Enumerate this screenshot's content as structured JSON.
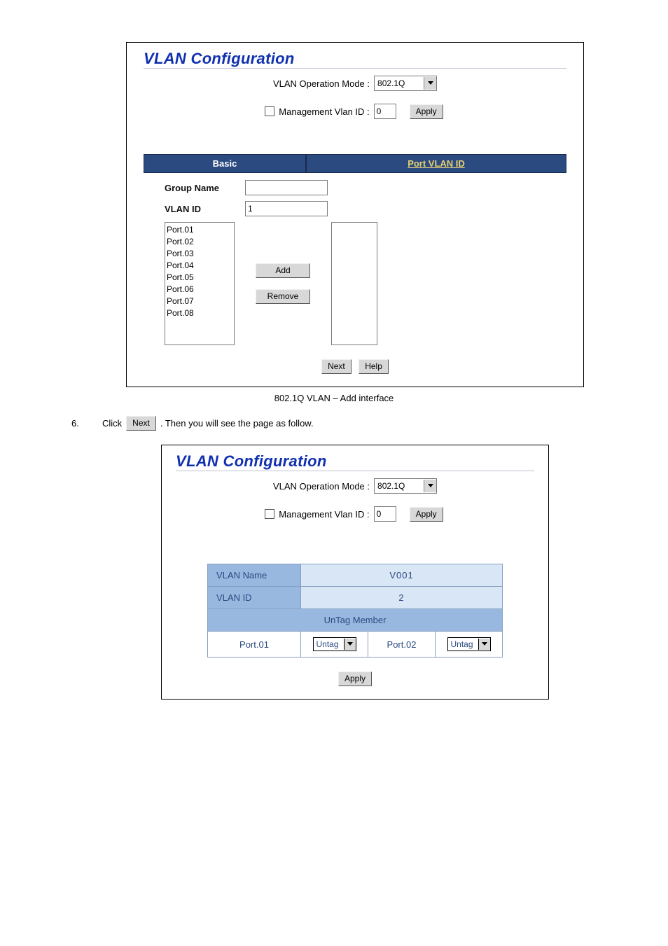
{
  "figure1": {
    "title": "VLAN Configuration",
    "op_mode_label": "VLAN Operation Mode :",
    "op_mode_value": "802.1Q",
    "mgmt_label": "Management Vlan ID :",
    "mgmt_value": "0",
    "apply_label": "Apply",
    "tabs": {
      "basic": "Basic",
      "port": "Port VLAN ID"
    },
    "group_name_label": "Group Name",
    "group_name_value": "",
    "vlan_id_label": "VLAN ID",
    "vlan_id_value": "1",
    "ports": [
      "Port.01",
      "Port.02",
      "Port.03",
      "Port.04",
      "Port.05",
      "Port.06",
      "Port.07",
      "Port.08"
    ],
    "add_label": "Add",
    "remove_label": "Remove",
    "next_label": "Next",
    "help_label": "Help",
    "caption": "802.1Q VLAN – Add interface"
  },
  "step6": {
    "num": "6.",
    "pre": "Click ",
    "btn": "Next",
    "post": ". Then you will see the page as follow."
  },
  "figure2": {
    "title": "VLAN Configuration",
    "op_mode_label": "VLAN Operation Mode :",
    "op_mode_value": "802.1Q",
    "mgmt_label": "Management Vlan ID :",
    "mgmt_value": "0",
    "apply_label": "Apply",
    "table": {
      "name_label": "VLAN Name",
      "name_value": "V001",
      "id_label": "VLAN ID",
      "id_value": "2",
      "untag_header": "UnTag Member",
      "rows": [
        {
          "port": "Port.01",
          "tag": "Untag"
        },
        {
          "port": "Port.02",
          "tag": "Untag"
        }
      ]
    },
    "apply2_label": "Apply"
  }
}
